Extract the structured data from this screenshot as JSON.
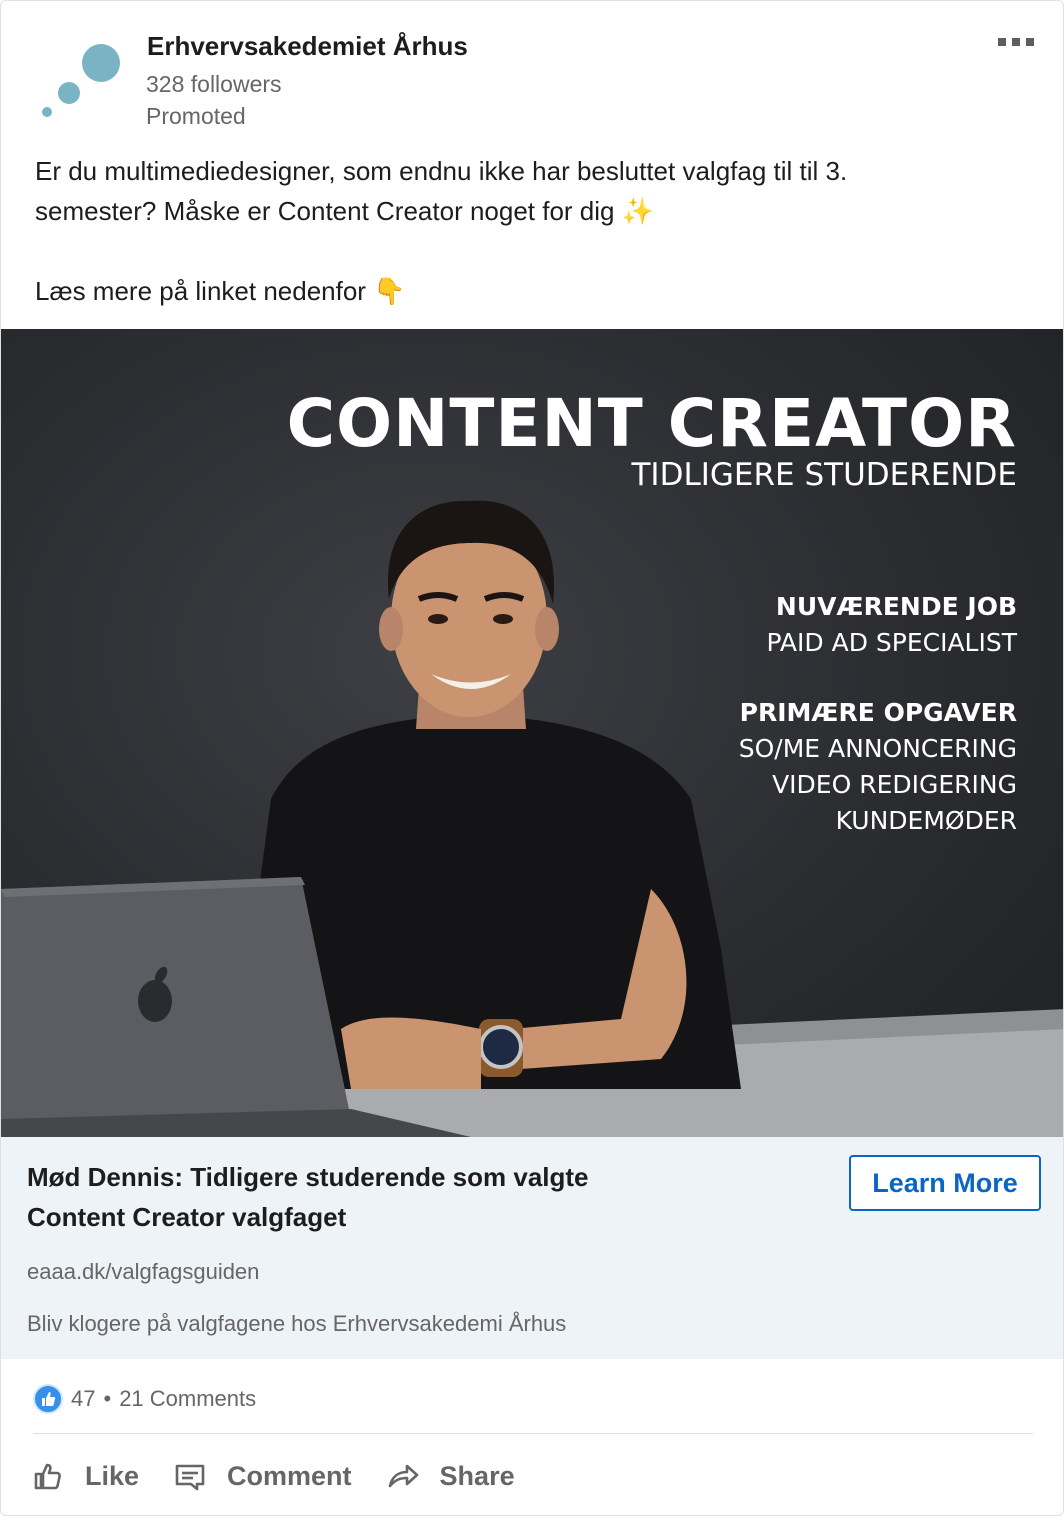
{
  "company": {
    "name": "Erhvervsakedemiet Århus",
    "followers": "328 followers",
    "promoted": "Promoted",
    "logo_icon": "bubbles-logo-icon",
    "logo_color": "#7ab4c4"
  },
  "more_menu": {
    "icon": "more-dots-icon"
  },
  "post": {
    "line1": "Er du multimediedesigner, som endnu ikke har besluttet valgfag til til 3.",
    "line2": "semester?  Måske er Content Creator noget for dig ✨",
    "line3": "Læs mere på linket nedenfor 👇"
  },
  "creative": {
    "title": "CONTENT CREATOR",
    "subtitle": "TIDLIGERE STUDERENDE",
    "job_heading": "NUVÆRENDE JOB",
    "job_value": "PAID AD SPECIALIST",
    "tasks_heading": "PRIMÆRE OPGAVER",
    "tasks": [
      "SO/ME ANNONCERING",
      "VIDEO REDIGERING",
      "KUNDEMØDER"
    ]
  },
  "link": {
    "title": "Mød Dennis: Tidligere studerende som valgte Content Creator valgfaget",
    "url": "eaaa.dk/valgfagsguiden",
    "description": "Bliv klogere på valgfagene hos Erhvervsakedemi Århus",
    "cta": "Learn More",
    "accent": "#0a66c2"
  },
  "social": {
    "likes": "47",
    "separator": "•",
    "comments": "21 Comments"
  },
  "actions": {
    "like": "Like",
    "comment": "Comment",
    "share": "Share"
  }
}
